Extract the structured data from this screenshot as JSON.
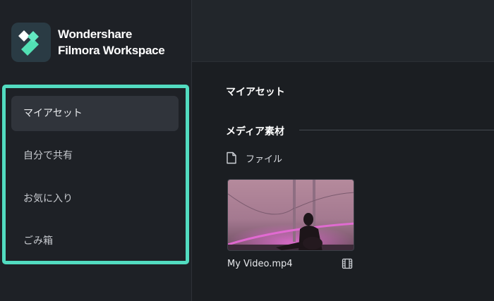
{
  "app": {
    "name_line1": "Wondershare",
    "name_line2": "Filmora Workspace",
    "logo_icon": "filmora-logo-icon"
  },
  "sidebar": {
    "items": [
      {
        "label": "マイアセット",
        "active": true
      },
      {
        "label": "自分で共有",
        "active": false
      },
      {
        "label": "お気に入り",
        "active": false
      },
      {
        "label": "ごみ箱",
        "active": false
      }
    ],
    "highlight_color": "#52dcc0"
  },
  "main": {
    "title": "マイアセット",
    "section": {
      "title": "メディア素材",
      "folder_label": "ファイル",
      "folder_icon": "document-icon"
    },
    "media": [
      {
        "name": "My Video.mp4",
        "type_icon": "film-icon"
      }
    ]
  },
  "colors": {
    "accent": "#52dcc0",
    "background": "#1b1e22",
    "sidebar": "#1e2126"
  }
}
